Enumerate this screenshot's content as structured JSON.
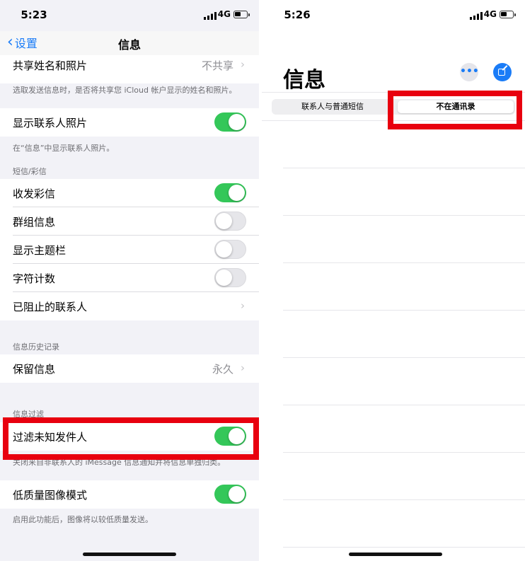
{
  "left": {
    "status": {
      "time": "5:23",
      "network": "4G"
    },
    "nav": {
      "back_label": "设置",
      "title": "信息"
    },
    "rows": {
      "share_name": {
        "label": "共享姓名和照片",
        "value": "不共享"
      },
      "share_note": "选取发送信息时，是否将共享您 iCloud 帐户显示的姓名和照片。",
      "show_contact_photos": {
        "label": "显示联系人照片",
        "on": true
      },
      "show_contact_note": "在“信息”中显示联系人照片。",
      "sms_section": "短信/彩信",
      "mms": {
        "label": "收发彩信",
        "on": true
      },
      "group": {
        "label": "群组信息",
        "on": false
      },
      "subject": {
        "label": "显示主题栏",
        "on": false
      },
      "charcount": {
        "label": "字符计数",
        "on": false
      },
      "blocked": {
        "label": "已阻止的联系人"
      },
      "history_section": "信息历史记录",
      "keep": {
        "label": "保留信息",
        "value": "永久"
      },
      "filter_section": "信息过滤",
      "filter_unknown": {
        "label": "过滤未知发件人",
        "on": true
      },
      "filter_note": "关闭来自非联系人的 iMessage 信息通知并将信息单独归类。",
      "lowquality": {
        "label": "低质量图像模式",
        "on": true
      },
      "lowquality_note": "启用此功能后，图像将以较低质量发送。"
    }
  },
  "right": {
    "status": {
      "time": "5:26",
      "network": "4G"
    },
    "title": "信息",
    "segments": [
      "联系人与普通短信",
      "不在通讯录"
    ],
    "selected_segment": "不在通讯录"
  },
  "colors": {
    "accent": "#1a7cf7",
    "toggle_on": "#34c759",
    "highlight": "#e8000f"
  },
  "icons": [
    "chevron-left-icon",
    "chevron-right-icon",
    "signal-icon",
    "battery-icon",
    "more-icon",
    "compose-icon"
  ]
}
